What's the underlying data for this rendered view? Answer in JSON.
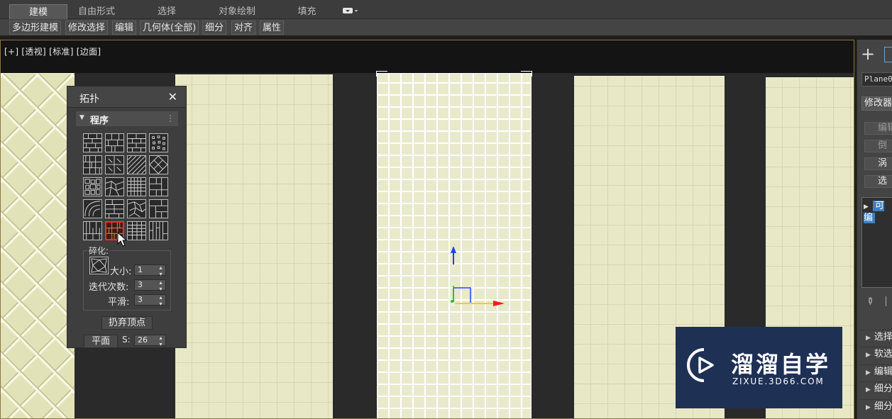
{
  "ribbon": {
    "tabs": [
      {
        "label": "建模",
        "active": true
      },
      {
        "label": "自由形式",
        "active": false
      },
      {
        "label": "选择",
        "active": false
      },
      {
        "label": "对象绘制",
        "active": false
      },
      {
        "label": "填充",
        "active": false
      }
    ],
    "extra_icon": "toggle-ribbon-icon",
    "buttons": [
      "多边形建模",
      "修改选择",
      "编辑",
      "几何体(全部)",
      "细分",
      "对齐",
      "属性"
    ]
  },
  "viewport": {
    "label": "[+] [透视] [标准] [边面]",
    "gizmo_axes": {
      "z": "z",
      "x": "x"
    }
  },
  "panel": {
    "title": "拓扑",
    "close_icon": "close-icon",
    "section": "程序",
    "tile_icons": [
      "brick-pattern-icon",
      "running-bond-icon",
      "stacked-brick-icon",
      "random-dots-icon",
      "basketweave-icon",
      "cross-bond-icon",
      "diagonal-hatch-icon",
      "diamond-lattice-icon",
      "cobblestone-icon",
      "random-stone-icon",
      "fine-checker-icon",
      "puzzle-icon",
      "curved-tile-icon",
      "mixed-brick-icon",
      "crazy-paving-icon",
      "block-pattern-icon",
      "herringbone-icon",
      "parquet-icon",
      "small-grid-icon",
      "vertical-strip-icon"
    ],
    "selected_tile_index": 17,
    "fragment_label": "碎化:",
    "fragment_icon": "fragment-icon",
    "size_label": "大小:",
    "size_value": "1",
    "iterations_label": "迭代次数:",
    "iterations_value": "3",
    "smooth_label": "平滑:",
    "smooth_value": "3",
    "discard_button": "扔弃顶点",
    "plane_button": "平面",
    "s_label": "S:",
    "s_value": "26"
  },
  "command_panel": {
    "create_icon": "plus-icon",
    "object_name": "Plane0",
    "modifier_list": "修改器",
    "buttons": [
      {
        "label": "编辑",
        "enabled": false
      },
      {
        "label": "倒",
        "enabled": false
      },
      {
        "label": "涡",
        "enabled": true
      },
      {
        "label": "选",
        "enabled": true
      }
    ],
    "stack_item": "可编",
    "pin_icon": "pin-icon",
    "rollouts": [
      "选择",
      "软选",
      "编辑",
      "细分",
      "细分"
    ]
  },
  "watermark": {
    "logo_icon": "play-logo-icon",
    "name": "溜溜自学",
    "url": "ZIXUE.3D66.COM"
  }
}
